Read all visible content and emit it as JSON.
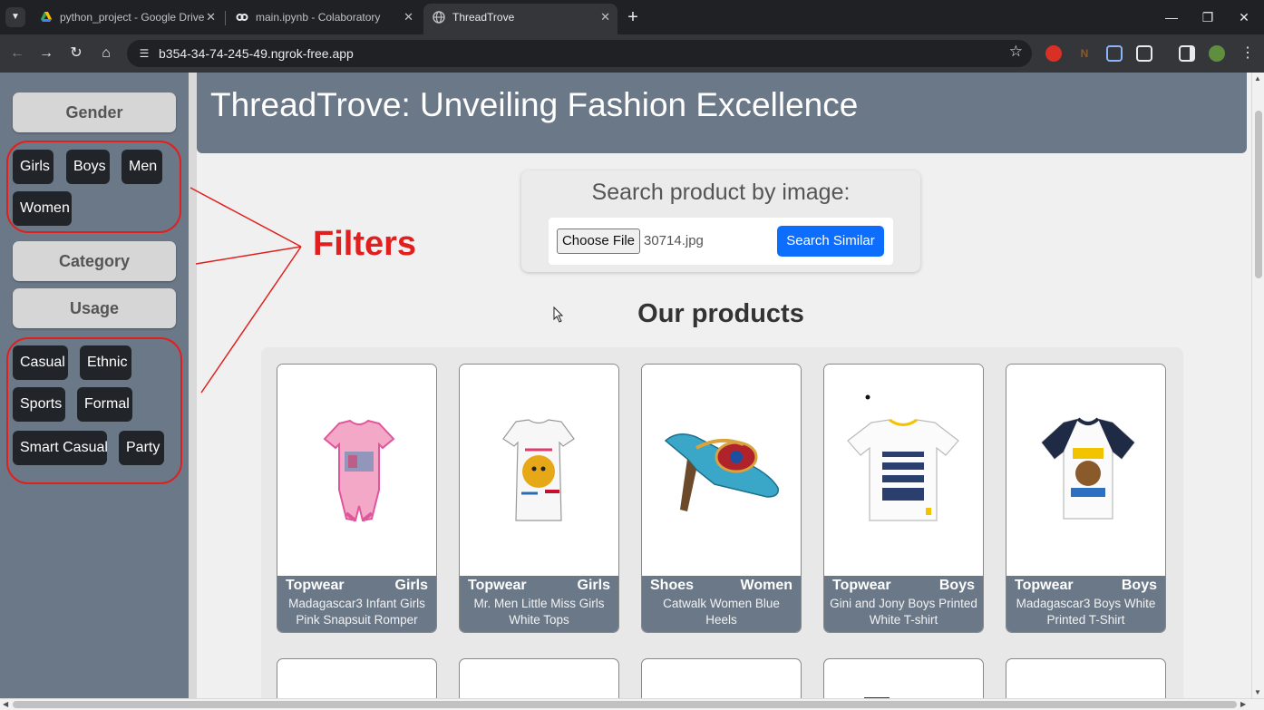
{
  "browser": {
    "tabs": [
      {
        "title": "python_project - Google Drive",
        "icon": "google-drive-icon"
      },
      {
        "title": "main.ipynb - Colaboratory",
        "icon": "colab-icon"
      },
      {
        "title": "ThreadTrove",
        "icon": "globe-icon",
        "active": true
      }
    ],
    "url": "b354-34-74-245-49.ngrok-free.app"
  },
  "sidebar": {
    "gender_label": "Gender",
    "gender_chips": [
      "Girls",
      "Boys",
      "Men",
      "Women"
    ],
    "category_label": "Category",
    "usage_label": "Usage",
    "usage_chips": [
      "Casual",
      "Ethnic",
      "Sports",
      "Formal",
      "Smart Casual",
      "Party"
    ]
  },
  "annotation": {
    "text": "Filters",
    "color": "#e0201f"
  },
  "header": {
    "title": "ThreadTrove: Unveiling Fashion Excellence"
  },
  "search": {
    "title": "Search product by image:",
    "choose_label": "Choose File",
    "file_name": "30714.jpg",
    "button_label": "Search Similar"
  },
  "products": {
    "title": "Our products",
    "items": [
      {
        "category": "Topwear",
        "gender": "Girls",
        "name": "Madagascar3 Infant Girls Pink Snapsuit Romper",
        "image": "pink-romper"
      },
      {
        "category": "Topwear",
        "gender": "Girls",
        "name": "Mr. Men Little Miss Girls White Tops",
        "image": "white-top"
      },
      {
        "category": "Shoes",
        "gender": "Women",
        "name": "Catwalk Women Blue Heels",
        "image": "blue-heels"
      },
      {
        "category": "Topwear",
        "gender": "Boys",
        "name": "Gini and Jony Boys Printed White T-shirt",
        "image": "white-tshirt"
      },
      {
        "category": "Topwear",
        "gender": "Boys",
        "name": "Madagascar3 Boys White Printed T-Shirt",
        "image": "navy-sleeve-tshirt"
      }
    ]
  },
  "colors": {
    "accent": "#0d6efd",
    "sidebar": "#6b7888",
    "chip": "#212529",
    "annotation": "#e0201f"
  }
}
